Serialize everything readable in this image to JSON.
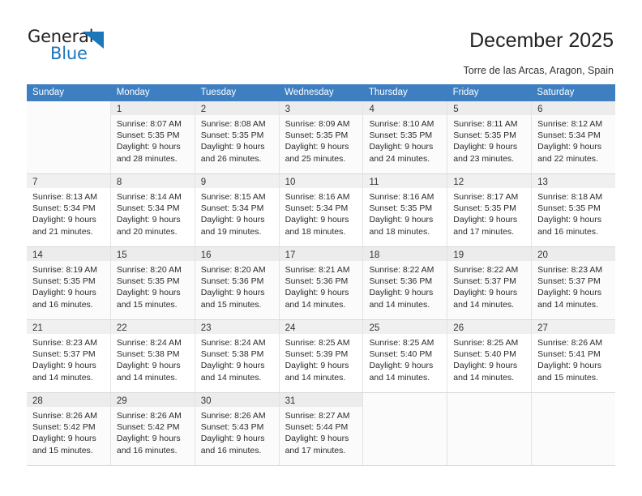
{
  "brand": {
    "name_part1": "General",
    "name_part2": "Blue",
    "accent_color": "#1c76bc",
    "triangle_icon": "triangle-icon"
  },
  "header": {
    "title": "December 2025",
    "subtitle": "Torre de las Arcas, Aragon, Spain"
  },
  "calendar": {
    "header_bg": "#3d7fc1",
    "weekdays": [
      "Sunday",
      "Monday",
      "Tuesday",
      "Wednesday",
      "Thursday",
      "Friday",
      "Saturday"
    ],
    "weeks": [
      [
        {
          "day": "",
          "lines": []
        },
        {
          "day": "1",
          "lines": [
            "Sunrise: 8:07 AM",
            "Sunset: 5:35 PM",
            "Daylight: 9 hours",
            "and 28 minutes."
          ]
        },
        {
          "day": "2",
          "lines": [
            "Sunrise: 8:08 AM",
            "Sunset: 5:35 PM",
            "Daylight: 9 hours",
            "and 26 minutes."
          ]
        },
        {
          "day": "3",
          "lines": [
            "Sunrise: 8:09 AM",
            "Sunset: 5:35 PM",
            "Daylight: 9 hours",
            "and 25 minutes."
          ]
        },
        {
          "day": "4",
          "lines": [
            "Sunrise: 8:10 AM",
            "Sunset: 5:35 PM",
            "Daylight: 9 hours",
            "and 24 minutes."
          ]
        },
        {
          "day": "5",
          "lines": [
            "Sunrise: 8:11 AM",
            "Sunset: 5:35 PM",
            "Daylight: 9 hours",
            "and 23 minutes."
          ]
        },
        {
          "day": "6",
          "lines": [
            "Sunrise: 8:12 AM",
            "Sunset: 5:34 PM",
            "Daylight: 9 hours",
            "and 22 minutes."
          ]
        }
      ],
      [
        {
          "day": "7",
          "lines": [
            "Sunrise: 8:13 AM",
            "Sunset: 5:34 PM",
            "Daylight: 9 hours",
            "and 21 minutes."
          ]
        },
        {
          "day": "8",
          "lines": [
            "Sunrise: 8:14 AM",
            "Sunset: 5:34 PM",
            "Daylight: 9 hours",
            "and 20 minutes."
          ]
        },
        {
          "day": "9",
          "lines": [
            "Sunrise: 8:15 AM",
            "Sunset: 5:34 PM",
            "Daylight: 9 hours",
            "and 19 minutes."
          ]
        },
        {
          "day": "10",
          "lines": [
            "Sunrise: 8:16 AM",
            "Sunset: 5:34 PM",
            "Daylight: 9 hours",
            "and 18 minutes."
          ]
        },
        {
          "day": "11",
          "lines": [
            "Sunrise: 8:16 AM",
            "Sunset: 5:35 PM",
            "Daylight: 9 hours",
            "and 18 minutes."
          ]
        },
        {
          "day": "12",
          "lines": [
            "Sunrise: 8:17 AM",
            "Sunset: 5:35 PM",
            "Daylight: 9 hours",
            "and 17 minutes."
          ]
        },
        {
          "day": "13",
          "lines": [
            "Sunrise: 8:18 AM",
            "Sunset: 5:35 PM",
            "Daylight: 9 hours",
            "and 16 minutes."
          ]
        }
      ],
      [
        {
          "day": "14",
          "lines": [
            "Sunrise: 8:19 AM",
            "Sunset: 5:35 PM",
            "Daylight: 9 hours",
            "and 16 minutes."
          ]
        },
        {
          "day": "15",
          "lines": [
            "Sunrise: 8:20 AM",
            "Sunset: 5:35 PM",
            "Daylight: 9 hours",
            "and 15 minutes."
          ]
        },
        {
          "day": "16",
          "lines": [
            "Sunrise: 8:20 AM",
            "Sunset: 5:36 PM",
            "Daylight: 9 hours",
            "and 15 minutes."
          ]
        },
        {
          "day": "17",
          "lines": [
            "Sunrise: 8:21 AM",
            "Sunset: 5:36 PM",
            "Daylight: 9 hours",
            "and 14 minutes."
          ]
        },
        {
          "day": "18",
          "lines": [
            "Sunrise: 8:22 AM",
            "Sunset: 5:36 PM",
            "Daylight: 9 hours",
            "and 14 minutes."
          ]
        },
        {
          "day": "19",
          "lines": [
            "Sunrise: 8:22 AM",
            "Sunset: 5:37 PM",
            "Daylight: 9 hours",
            "and 14 minutes."
          ]
        },
        {
          "day": "20",
          "lines": [
            "Sunrise: 8:23 AM",
            "Sunset: 5:37 PM",
            "Daylight: 9 hours",
            "and 14 minutes."
          ]
        }
      ],
      [
        {
          "day": "21",
          "lines": [
            "Sunrise: 8:23 AM",
            "Sunset: 5:37 PM",
            "Daylight: 9 hours",
            "and 14 minutes."
          ]
        },
        {
          "day": "22",
          "lines": [
            "Sunrise: 8:24 AM",
            "Sunset: 5:38 PM",
            "Daylight: 9 hours",
            "and 14 minutes."
          ]
        },
        {
          "day": "23",
          "lines": [
            "Sunrise: 8:24 AM",
            "Sunset: 5:38 PM",
            "Daylight: 9 hours",
            "and 14 minutes."
          ]
        },
        {
          "day": "24",
          "lines": [
            "Sunrise: 8:25 AM",
            "Sunset: 5:39 PM",
            "Daylight: 9 hours",
            "and 14 minutes."
          ]
        },
        {
          "day": "25",
          "lines": [
            "Sunrise: 8:25 AM",
            "Sunset: 5:40 PM",
            "Daylight: 9 hours",
            "and 14 minutes."
          ]
        },
        {
          "day": "26",
          "lines": [
            "Sunrise: 8:25 AM",
            "Sunset: 5:40 PM",
            "Daylight: 9 hours",
            "and 14 minutes."
          ]
        },
        {
          "day": "27",
          "lines": [
            "Sunrise: 8:26 AM",
            "Sunset: 5:41 PM",
            "Daylight: 9 hours",
            "and 15 minutes."
          ]
        }
      ],
      [
        {
          "day": "28",
          "lines": [
            "Sunrise: 8:26 AM",
            "Sunset: 5:42 PM",
            "Daylight: 9 hours",
            "and 15 minutes."
          ]
        },
        {
          "day": "29",
          "lines": [
            "Sunrise: 8:26 AM",
            "Sunset: 5:42 PM",
            "Daylight: 9 hours",
            "and 16 minutes."
          ]
        },
        {
          "day": "30",
          "lines": [
            "Sunrise: 8:26 AM",
            "Sunset: 5:43 PM",
            "Daylight: 9 hours",
            "and 16 minutes."
          ]
        },
        {
          "day": "31",
          "lines": [
            "Sunrise: 8:27 AM",
            "Sunset: 5:44 PM",
            "Daylight: 9 hours",
            "and 17 minutes."
          ]
        },
        {
          "day": "",
          "lines": []
        },
        {
          "day": "",
          "lines": []
        },
        {
          "day": "",
          "lines": []
        }
      ]
    ]
  }
}
